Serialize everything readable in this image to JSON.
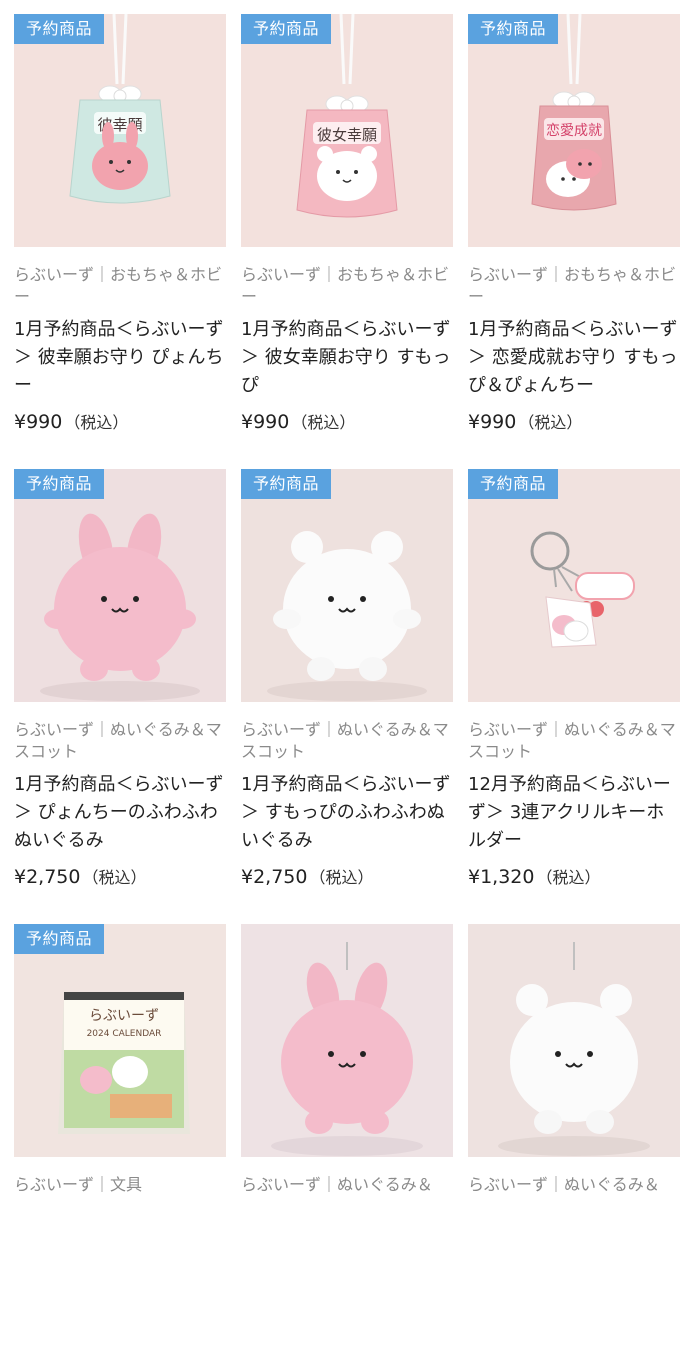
{
  "products": [
    {
      "badge": "予約商品",
      "brand": "らぶいーず",
      "category": "｜おもちゃ＆ホビー",
      "title": "1月予約商品＜らぶいーず＞ 彼幸願お守り ぴょんちー",
      "price": "¥990",
      "tax": "（税込）",
      "image": "omamori-mint-rabbit"
    },
    {
      "badge": "予約商品",
      "brand": "らぶいーず",
      "category": "｜おもちゃ＆ホビー",
      "title": "1月予約商品＜らぶいーず＞ 彼女幸願お守り すもっぴ",
      "price": "¥990",
      "tax": "（税込）",
      "image": "omamori-pink-bear"
    },
    {
      "badge": "予約商品",
      "brand": "らぶいーず",
      "category": "｜おもちゃ＆ホビー",
      "title": "1月予約商品＜らぶいーず＞ 恋愛成就お守り すもっぴ＆ぴょんちー",
      "price": "¥990",
      "tax": "（税込）",
      "image": "omamori-rose-pair"
    },
    {
      "badge": "予約商品",
      "brand": "らぶいーず",
      "category": "｜ぬいぐるみ＆マスコット",
      "title": "1月予約商品＜らぶいーず＞ ぴょんちーのふわふわぬいぐるみ",
      "price": "¥2,750",
      "tax": "（税込）",
      "image": "plush-pink-rabbit"
    },
    {
      "badge": "予約商品",
      "brand": "らぶいーず",
      "category": "｜ぬいぐるみ＆マスコット",
      "title": "1月予約商品＜らぶいーず＞ すもっぴのふわふわぬいぐるみ",
      "price": "¥2,750",
      "tax": "（税込）",
      "image": "plush-white-bear"
    },
    {
      "badge": "予約商品",
      "brand": "らぶいーず",
      "category": "｜ぬいぐるみ＆マスコット",
      "title": "12月予約商品＜らぶいーず＞ 3連アクリルキーホルダー",
      "price": "¥1,320",
      "tax": "（税込）",
      "image": "acrylic-keyholder"
    },
    {
      "badge": "予約商品",
      "brand": "らぶいーず",
      "category": "｜文具",
      "title": "",
      "price": "",
      "tax": "",
      "image": "desk-calendar",
      "calendar_logo": "らぶいーず",
      "calendar_text": "2024 CALENDAR"
    },
    {
      "badge": "",
      "brand": "らぶいーず",
      "category": "｜ぬいぐるみ＆",
      "title": "",
      "price": "",
      "tax": "",
      "image": "mascot-pink-rabbit"
    },
    {
      "badge": "",
      "brand": "らぶいーず",
      "category": "｜ぬいぐるみ＆",
      "title": "",
      "price": "",
      "tax": "",
      "image": "mascot-white-bear"
    }
  ],
  "omamori_labels": [
    "彼幸願",
    "彼女幸願",
    "恋愛成就"
  ],
  "colors": {
    "badge": "#5aa2df",
    "meta_text": "#8a8a8a",
    "background": "#ffffff"
  }
}
